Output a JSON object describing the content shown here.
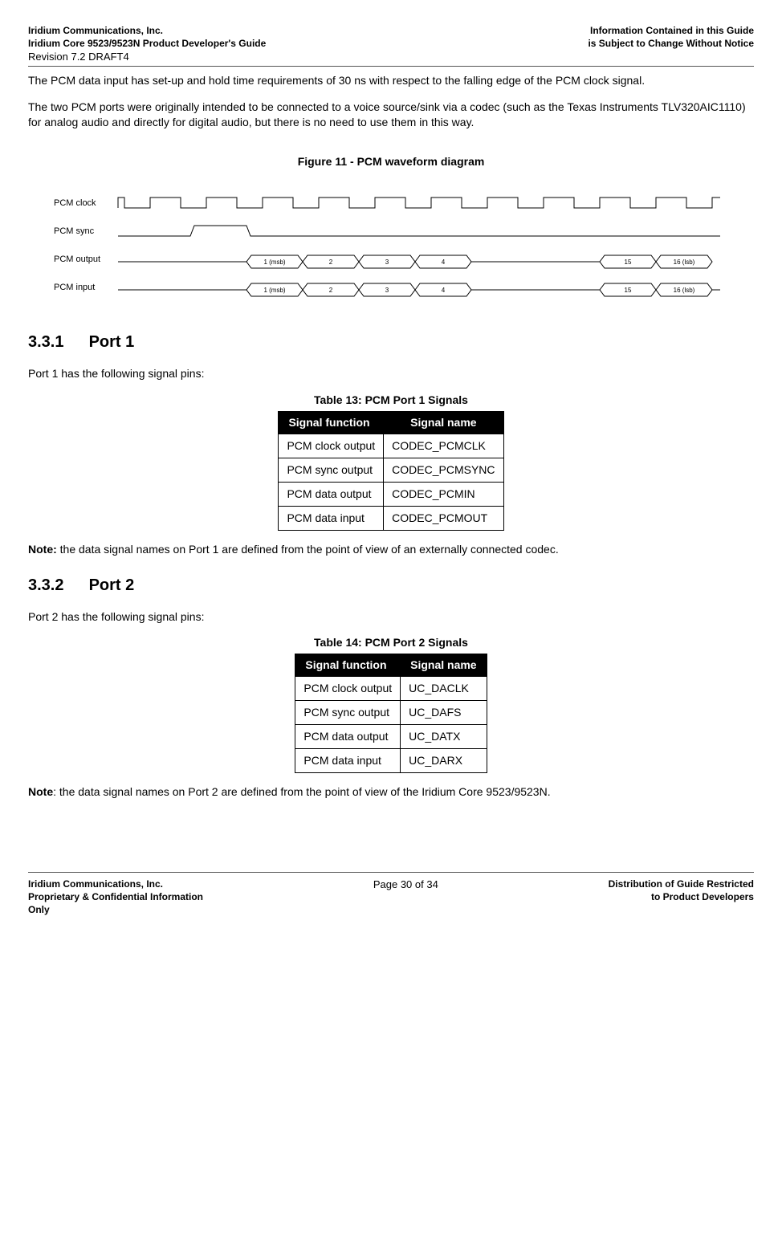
{
  "header": {
    "left1": "Iridium Communications, Inc.",
    "left2": "Iridium Core 9523/9523N Product Developer's Guide",
    "left3": "Revision 7.2 DRAFT4",
    "right1": "Information Contained in this Guide",
    "right2": "is Subject to Change Without Notice"
  },
  "para1": "The PCM data input has set-up and hold time requirements of 30 ns with respect to the falling edge of the PCM clock signal.",
  "para2": "The two PCM ports were originally intended to be connected to a voice source/sink via a codec (such as the Texas Instruments TLV320AIC1110) for analog audio and directly for digital audio, but there is no need to use them in this way.",
  "figure_title": "Figure 11 - PCM waveform diagram",
  "waveform": {
    "labels": {
      "clock": "PCM clock",
      "sync": "PCM sync",
      "output": "PCM output",
      "input": "PCM input"
    },
    "bits": {
      "b1": "1 (msb)",
      "b2": "2",
      "b3": "3",
      "b4": "4",
      "b15": "15",
      "b16": "16 (lsb)"
    }
  },
  "port1": {
    "heading_num": "3.3.1",
    "heading_text": "Port 1",
    "intro": "Port 1 has the following signal pins:",
    "table_title": "Table 13: PCM Port 1 Signals",
    "th1": "Signal function",
    "th2": "Signal name",
    "rows": [
      {
        "f": "PCM clock output",
        "n": "CODEC_PCMCLK"
      },
      {
        "f": "PCM sync output",
        "n": "CODEC_PCMSYNC"
      },
      {
        "f": "PCM data output",
        "n": "CODEC_PCMIN"
      },
      {
        "f": "PCM data input",
        "n": "CODEC_PCMOUT"
      }
    ],
    "note_label": "Note:",
    "note": " the data signal names on Port 1 are defined from the point of view of an externally connected codec."
  },
  "port2": {
    "heading_num": "3.3.2",
    "heading_text": "Port 2",
    "intro": "Port 2 has the following signal pins:",
    "table_title": "Table 14: PCM Port 2 Signals",
    "th1": "Signal function",
    "th2": "Signal name",
    "rows": [
      {
        "f": "PCM clock output",
        "n": "UC_DACLK"
      },
      {
        "f": "PCM sync output",
        "n": "UC_DAFS"
      },
      {
        "f": "PCM data output",
        "n": "UC_DATX"
      },
      {
        "f": "PCM data input",
        "n": "UC_DARX"
      }
    ],
    "note_label": "Note",
    "note": ": the data signal names on Port 2 are defined from the point of view of the Iridium Core 9523/9523N."
  },
  "footer": {
    "left1": "Iridium Communications, Inc.",
    "left2": "Proprietary & Confidential Information",
    "left3": "Only",
    "center": "Page 30 of 34",
    "right1": "Distribution of Guide Restricted",
    "right2": "to Product Developers"
  }
}
